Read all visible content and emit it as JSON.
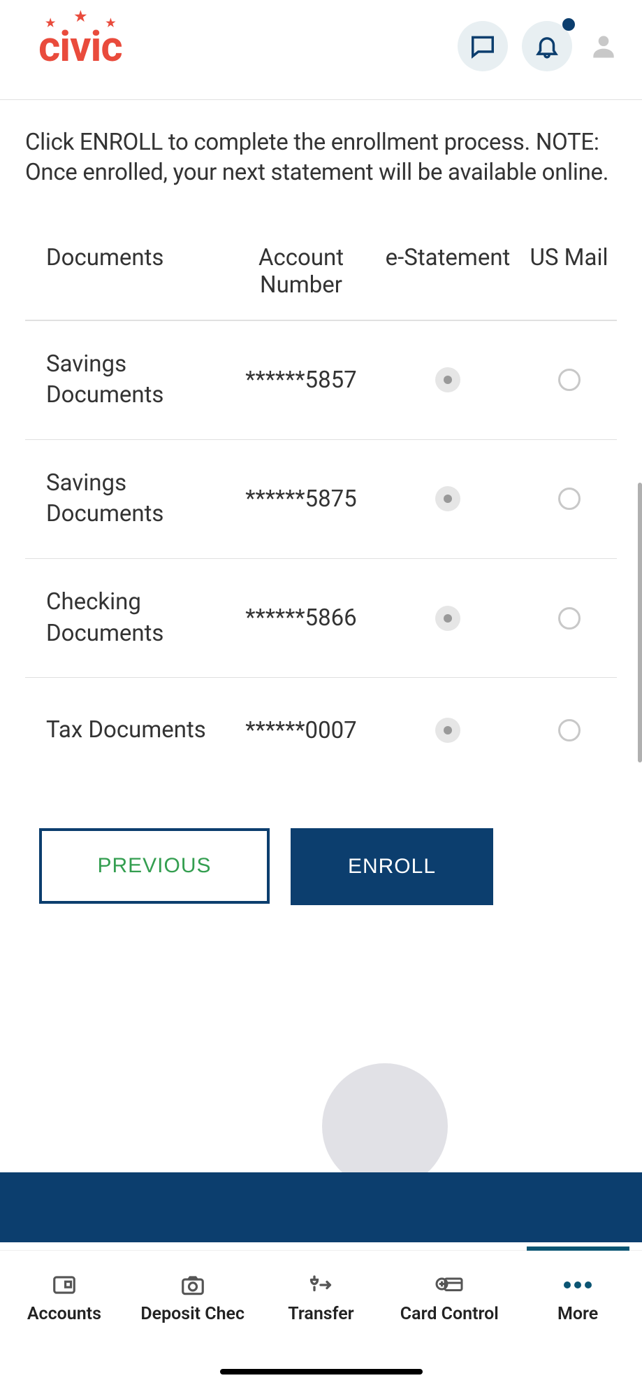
{
  "logo": {
    "text": "civic"
  },
  "instruction": "Click ENROLL to complete the enrollment process. NOTE: Once enrolled, your next statement will be available online.",
  "table": {
    "headers": {
      "documents": "Documents",
      "account": "Account Number",
      "estatement": "e-Statement",
      "usmail": "US Mail"
    },
    "rows": [
      {
        "documents": "Savings Documents",
        "account": "******5857",
        "selected": "estatement"
      },
      {
        "documents": "Savings Documents",
        "account": "******5875",
        "selected": "estatement"
      },
      {
        "documents": "Checking Documents",
        "account": "******5866",
        "selected": "estatement"
      },
      {
        "documents": "Tax Documents",
        "account": "******0007",
        "selected": "estatement"
      }
    ]
  },
  "buttons": {
    "previous": "PREVIOUS",
    "enroll": "ENROLL"
  },
  "nav": {
    "accounts": "Accounts",
    "deposit": "Deposit Chec",
    "transfer": "Transfer",
    "card": "Card Control",
    "more": "More"
  }
}
